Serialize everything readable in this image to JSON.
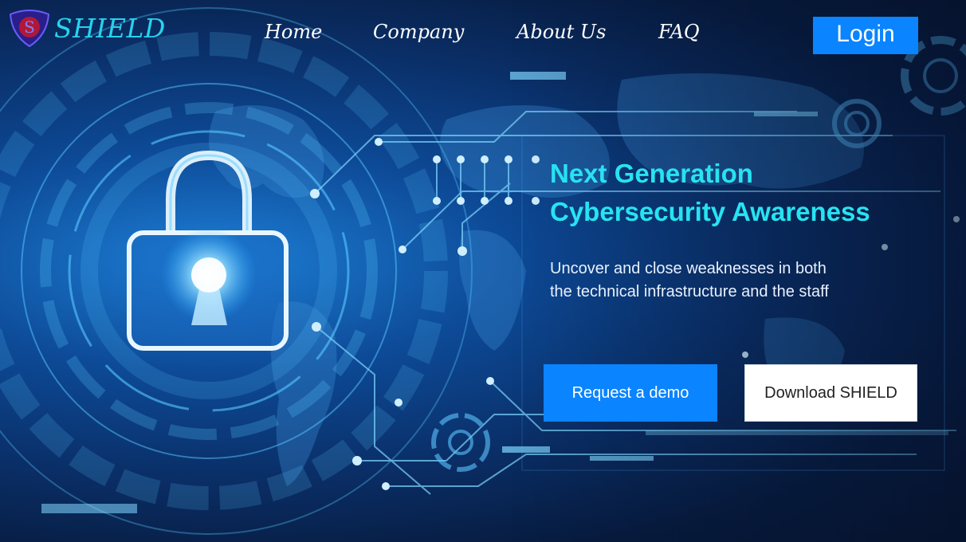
{
  "brand": {
    "name": "SHIELD",
    "logo_icon": "shield-icon",
    "logo_letter": "S"
  },
  "nav": {
    "items": [
      {
        "label": "Home"
      },
      {
        "label": "Company"
      },
      {
        "label": "About Us"
      },
      {
        "label": "FAQ"
      }
    ],
    "login_label": "Login"
  },
  "hero": {
    "headline_line1": "Next Generation",
    "headline_line2": "Cybersecurity Awareness",
    "subtitle_line1": "Uncover and close weaknesses in both",
    "subtitle_line2": "the technical infrastructure and the staff",
    "primary_button": "Request a demo",
    "secondary_button": "Download SHIELD",
    "background_icon": "padlock-icon"
  },
  "colors": {
    "accent": "#0a84ff",
    "headline": "#27e3f2",
    "brand_text": "#27d3ec",
    "background_dark": "#071a3c"
  }
}
